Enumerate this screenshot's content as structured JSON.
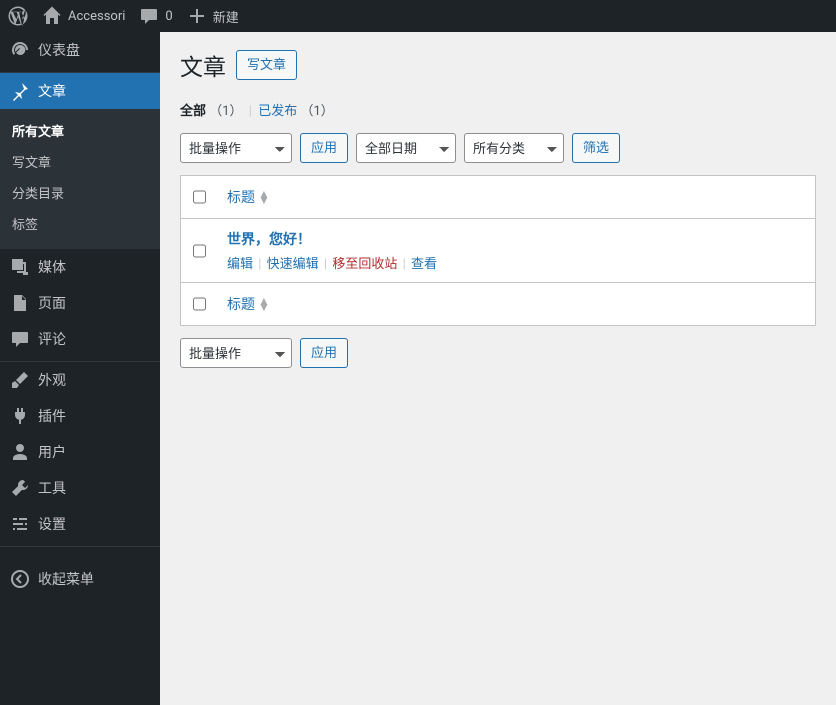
{
  "topbar": {
    "site_name": "Accessori",
    "comments_count": "0",
    "new_label": "新建"
  },
  "sidebar": {
    "dashboard": "仪表盘",
    "posts": "文章",
    "posts_sub": {
      "all": "所有文章",
      "new": "写文章",
      "categories": "分类目录",
      "tags": "标签"
    },
    "media": "媒体",
    "pages": "页面",
    "comments": "评论",
    "appearance": "外观",
    "plugins": "插件",
    "users": "用户",
    "tools": "工具",
    "settings": "设置",
    "collapse": "收起菜单"
  },
  "content": {
    "heading": "文章",
    "add_new": "写文章",
    "filters": {
      "all_label": "全部",
      "all_count": "（1）",
      "published_label": "已发布",
      "published_count": "（1）"
    },
    "bulk_action_label": "批量操作",
    "apply_label": "应用",
    "date_filter_label": "全部日期",
    "cat_filter_label": "所有分类",
    "filter_btn": "筛选",
    "col_title": "标题",
    "post": {
      "title": "世界，您好！",
      "edit": "编辑",
      "quick_edit": "快速编辑",
      "trash": "移至回收站",
      "view": "查看"
    }
  }
}
